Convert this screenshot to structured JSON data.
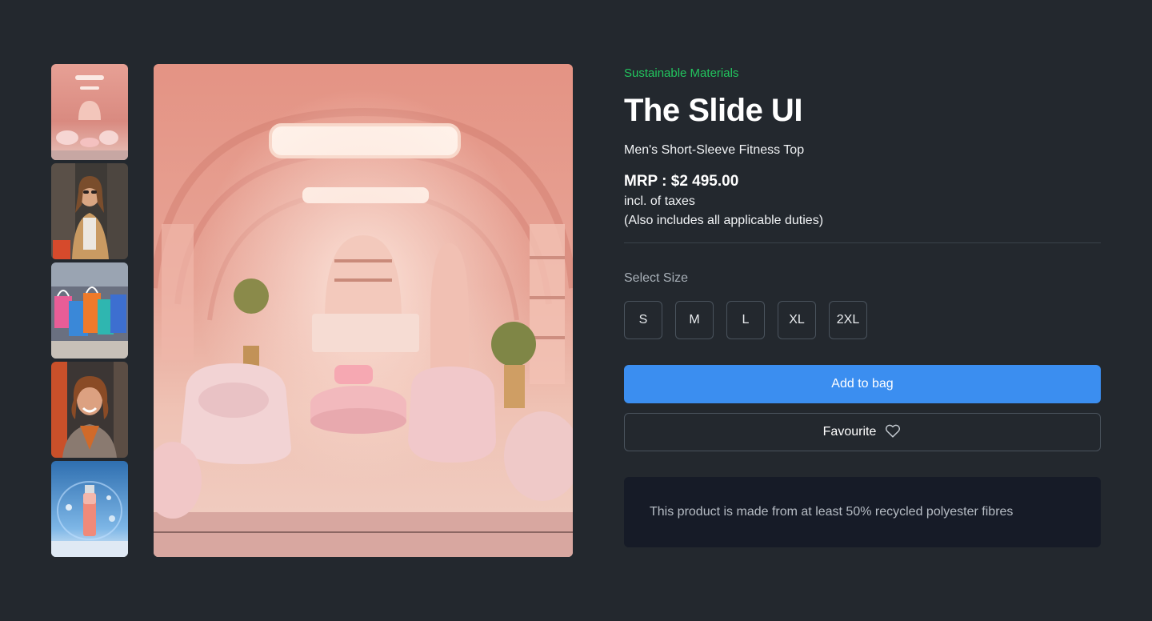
{
  "gallery": {
    "thumbnails": [
      {
        "label": "store-interior"
      },
      {
        "label": "woman-shopping"
      },
      {
        "label": "shopping-bags"
      },
      {
        "label": "smiling-woman"
      },
      {
        "label": "cosmetic-bottle"
      }
    ],
    "main_image": "store-interior"
  },
  "product": {
    "eyebrow": "Sustainable Materials",
    "title": "The Slide UI",
    "subtitle": "Men's Short-Sleeve Fitness Top",
    "price": "MRP : $2 495.00",
    "tax_note": "incl. of taxes",
    "duties_note": "(Also includes all applicable duties)"
  },
  "size_selector": {
    "label": "Select Size",
    "options": [
      "S",
      "M",
      "L",
      "XL",
      "2XL"
    ]
  },
  "actions": {
    "add_to_bag": "Add to bag",
    "favourite": "Favourite",
    "favourite_icon": "heart-icon"
  },
  "info": {
    "note": "This product is made from at least 50% recycled polyester fibres"
  },
  "colors": {
    "background": "#23282e",
    "accent_green": "#22c55e",
    "primary_button": "#3b8ef0",
    "note_panel": "#161b27"
  }
}
